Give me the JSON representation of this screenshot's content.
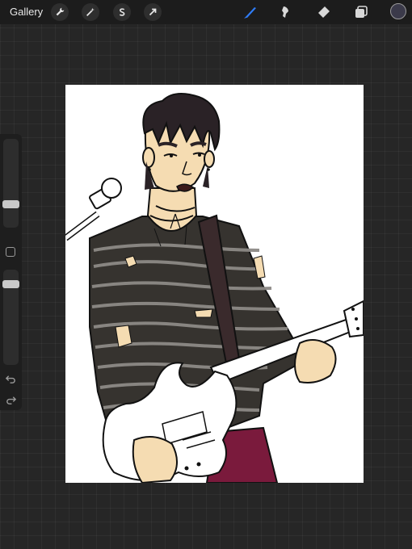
{
  "topbar": {
    "gallery_label": "Gallery",
    "actions_icon": "wrench-icon",
    "adjustments_icon": "magic-wand-icon",
    "selection_icon": "selection-s-icon",
    "transform_icon": "arrow-cursor-icon",
    "brush_icon": "brush-icon",
    "smudge_icon": "smudge-icon",
    "eraser_icon": "eraser-icon",
    "layers_icon": "layers-icon",
    "current_color": "#3b3a4a",
    "active_tool_color": "#2f7cf6"
  },
  "sidebar": {
    "brush_size_level": 0.72,
    "opacity_level": 0.06,
    "undo_icon": "undo-icon",
    "redo_icon": "redo-icon"
  },
  "canvas": {
    "description_colors": {
      "skin": "#f5dcb2",
      "hair": "#2a2226",
      "sweater": "#36332f",
      "stripes": "#8d8a86",
      "pants": "#7a1a3c",
      "guitar": "#ffffff"
    }
  }
}
